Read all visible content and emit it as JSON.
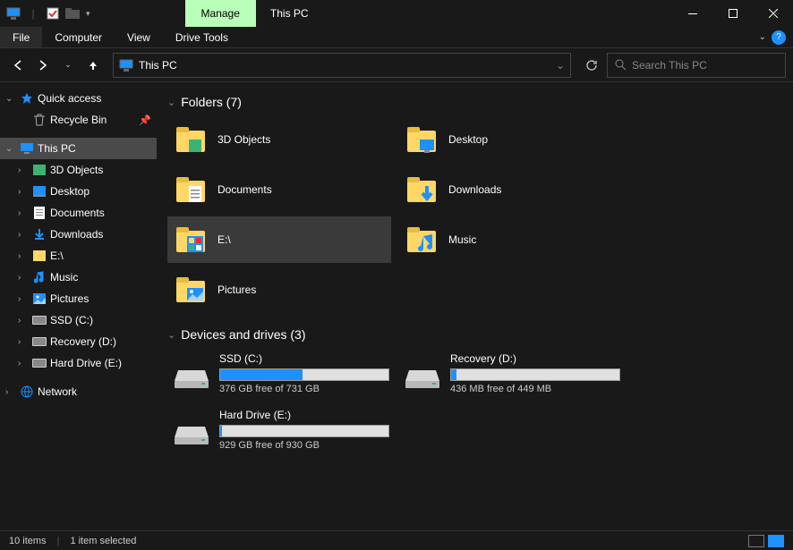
{
  "title": "This PC",
  "manage_tab": "Manage",
  "menubar": {
    "file": "File",
    "computer": "Computer",
    "view": "View",
    "drive_tools": "Drive Tools"
  },
  "address": "This PC",
  "search": {
    "placeholder": "Search This PC"
  },
  "sidebar": {
    "quick_access": "Quick access",
    "recycle_bin": "Recycle Bin",
    "this_pc": "This PC",
    "items": [
      {
        "label": "3D Objects"
      },
      {
        "label": "Desktop"
      },
      {
        "label": "Documents"
      },
      {
        "label": "Downloads"
      },
      {
        "label": "E:\\"
      },
      {
        "label": "Music"
      },
      {
        "label": "Pictures"
      },
      {
        "label": "SSD (C:)"
      },
      {
        "label": "Recovery (D:)"
      },
      {
        "label": "Hard Drive (E:)"
      }
    ],
    "network": "Network"
  },
  "sections": {
    "folders": "Folders (7)",
    "drives": "Devices and drives (3)"
  },
  "folders": [
    {
      "label": "3D Objects"
    },
    {
      "label": "Desktop"
    },
    {
      "label": "Documents"
    },
    {
      "label": "Downloads"
    },
    {
      "label": "E:\\"
    },
    {
      "label": "Music"
    },
    {
      "label": "Pictures"
    }
  ],
  "drives": [
    {
      "name": "SSD (C:)",
      "free_text": "376 GB free of 731 GB",
      "fill_pct": 49
    },
    {
      "name": "Recovery (D:)",
      "free_text": "436 MB free of 449 MB",
      "fill_pct": 3
    },
    {
      "name": "Hard Drive (E:)",
      "free_text": "929 GB free of 930 GB",
      "fill_pct": 1
    }
  ],
  "statusbar": {
    "count": "10 items",
    "selection": "1 item selected"
  }
}
